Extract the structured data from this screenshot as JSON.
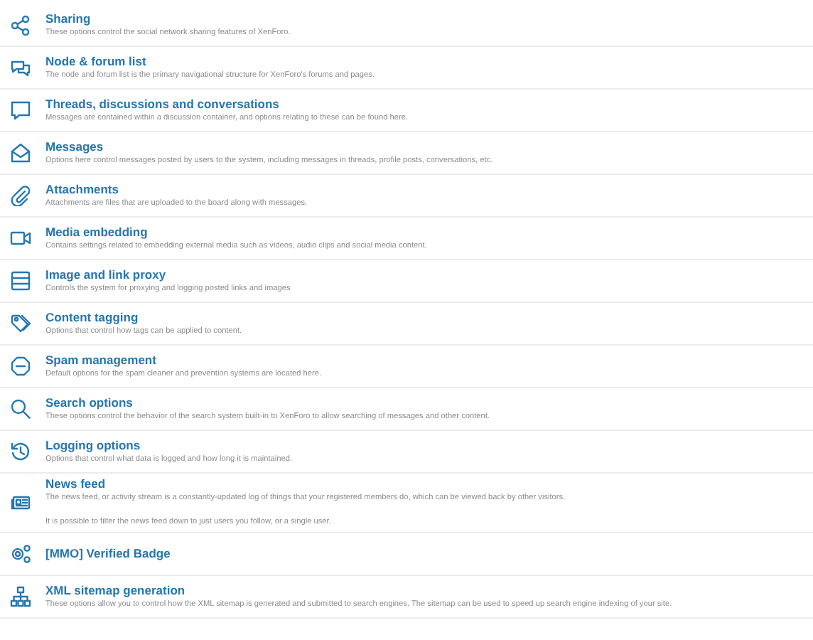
{
  "options": [
    {
      "title": "Sharing",
      "description": [
        "These options control the social network sharing features of XenForo."
      ]
    },
    {
      "title": "Node & forum list",
      "description": [
        "The node and forum list is the primary navigational structure for XenForo's forums and pages."
      ]
    },
    {
      "title": "Threads, discussions and conversations",
      "description": [
        "Messages are contained within a discussion container, and options relating to these can be found here."
      ]
    },
    {
      "title": "Messages",
      "description": [
        "Options here control messages posted by users to the system, including messages in threads, profile posts, conversations, etc."
      ]
    },
    {
      "title": "Attachments",
      "description": [
        "Attachments are files that are uploaded to the board along with messages."
      ]
    },
    {
      "title": "Media embedding",
      "description": [
        "Contains settings related to embedding external media such as videos, audio clips and social media content."
      ]
    },
    {
      "title": "Image and link proxy",
      "description": [
        "Controls the system for proxying and logging posted links and images"
      ]
    },
    {
      "title": "Content tagging",
      "description": [
        "Options that control how tags can be applied to content."
      ]
    },
    {
      "title": "Spam management",
      "description": [
        "Default options for the spam cleaner and prevention systems are located here."
      ]
    },
    {
      "title": "Search options",
      "description": [
        "These options control the behavior of the search system built-in to XenForo to allow searching of messages and other content."
      ]
    },
    {
      "title": "Logging options",
      "description": [
        "Options that control what data is logged and how long it is maintained."
      ]
    },
    {
      "title": "News feed",
      "description": [
        "The news feed, or activity stream is a constantly-updated log of things that your registered members do, which can be viewed back by other visitors.",
        "It is possible to filter the news feed down to just users you follow, or a single user."
      ]
    },
    {
      "title": "[MMO] Verified Badge"
    },
    {
      "title": "XML sitemap generation",
      "description": [
        "These options allow you to control how the XML sitemap is generated and submitted to search engines. The sitemap can be used to speed up search engine indexing of your site."
      ]
    }
  ]
}
